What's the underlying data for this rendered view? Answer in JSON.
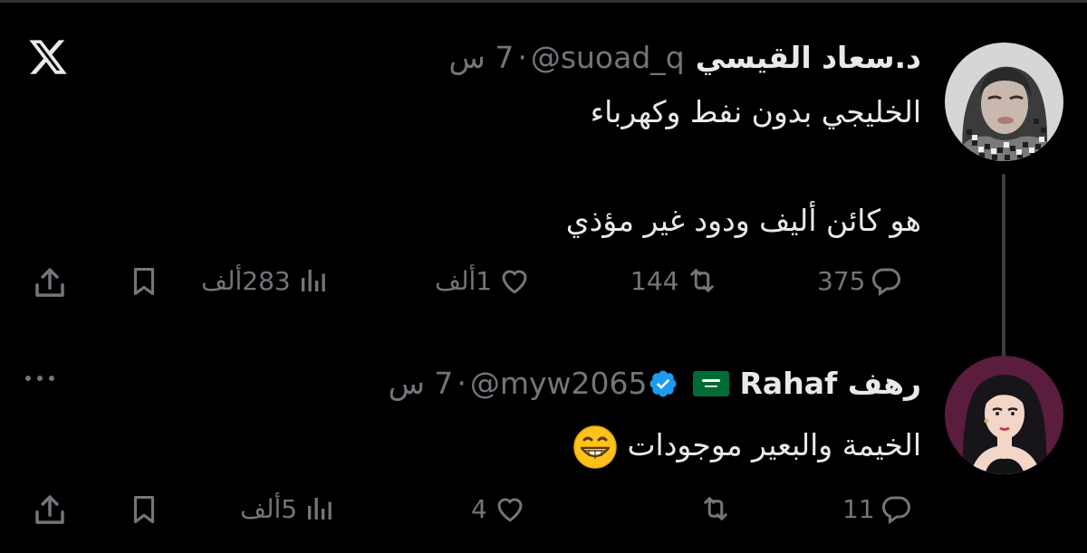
{
  "tweet1": {
    "name": "د.سعاد القيسي",
    "handle": "@suoad_q",
    "separator": "·",
    "time": "7 س",
    "text_line1": "الخليجي بدون نفط وكهرباء",
    "text_line2": "هو كائن أليف ودود غير مؤذي",
    "replies": "375",
    "retweets": "144",
    "likes": "1ألف",
    "views": "283ألف"
  },
  "tweet2": {
    "name": "رهف Rahaf",
    "flag_icon": "saudi-flag",
    "verified_icon": "verified-badge",
    "handle": "@myw2065",
    "separator": "·",
    "time": "7 س",
    "text": "الخيمة والبعير موجودات",
    "emoji": "grinning-face-emoji",
    "replies": "11",
    "retweets": "",
    "likes": "4",
    "views": "5ألف"
  },
  "colors": {
    "background": "#000000",
    "text_primary": "#e7e9ea",
    "text_secondary": "#71767b",
    "verified": "#1d9bf0",
    "thread_line": "#3a3f44"
  }
}
